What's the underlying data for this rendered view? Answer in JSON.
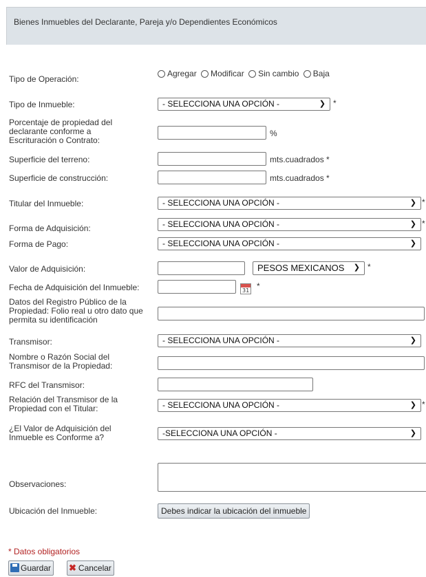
{
  "section_title": "Bienes Inmuebles del Declarante, Pareja y/o Dependientes Económicos",
  "operation": {
    "label": "Tipo de Operación:",
    "options": [
      "Agregar",
      "Modificar",
      "Sin cambio",
      "Baja"
    ]
  },
  "tipo_inmueble": {
    "label": "Tipo de Inmueble:",
    "value": "- SELECCIONA UNA OPCIÓN -"
  },
  "porcentaje": {
    "label": "Porcentaje de propiedad del declarante conforme a Escrituración o Contrato:",
    "value": "",
    "unit": "%"
  },
  "superficie_terreno": {
    "label": "Superficie del terreno:",
    "value": "",
    "unit": "mts.cuadrados *"
  },
  "superficie_construccion": {
    "label": "Superficie de construcción:",
    "value": "",
    "unit": "mts.cuadrados *"
  },
  "titular": {
    "label": "Titular del Inmueble:",
    "value": "- SELECCIONA UNA OPCIÓN -"
  },
  "forma_adquisicion": {
    "label": "Forma de Adquisición:",
    "value": "- SELECCIONA UNA OPCIÓN -"
  },
  "forma_pago": {
    "label": "Forma de Pago:",
    "value": "- SELECCIONA UNA OPCIÓN -"
  },
  "valor_adquisicion": {
    "label": "Valor de Adquisición:",
    "value": "",
    "currency": "PESOS MEXICANOS"
  },
  "fecha_adquisicion": {
    "label": "Fecha de Adquisición del Inmueble:",
    "value": "",
    "calendar_text": "31"
  },
  "registro_publico": {
    "label": "Datos del Registro Público de la Propiedad: Folio real u otro dato que permita su identificación",
    "value": ""
  },
  "transmisor": {
    "label": "Transmisor:",
    "value": "- SELECCIONA UNA OPCIÓN -"
  },
  "nombre_transmisor": {
    "label": "Nombre o Razón Social del Transmisor de la Propiedad:",
    "value": ""
  },
  "rfc_transmisor": {
    "label": "RFC del Transmisor:",
    "value": ""
  },
  "relacion_transmisor": {
    "label": "Relación del Transmisor de la Propiedad con el Titular:",
    "value": "- SELECCIONA UNA OPCIÓN -"
  },
  "valor_conforme": {
    "label": "¿El Valor de Adquisición del Inmueble es Conforme a?",
    "value": "-SELECCIONA UNA OPCIÓN -"
  },
  "observaciones": {
    "label": "Observaciones:",
    "value": ""
  },
  "ubicacion": {
    "label": "Ubicación del Inmueble:",
    "button": "Debes indicar la ubicación del inmueble"
  },
  "required_marker": "*",
  "footer": {
    "required_note": "* Datos obligatorios",
    "save_label": "Guardar",
    "cancel_label": "Cancelar"
  }
}
